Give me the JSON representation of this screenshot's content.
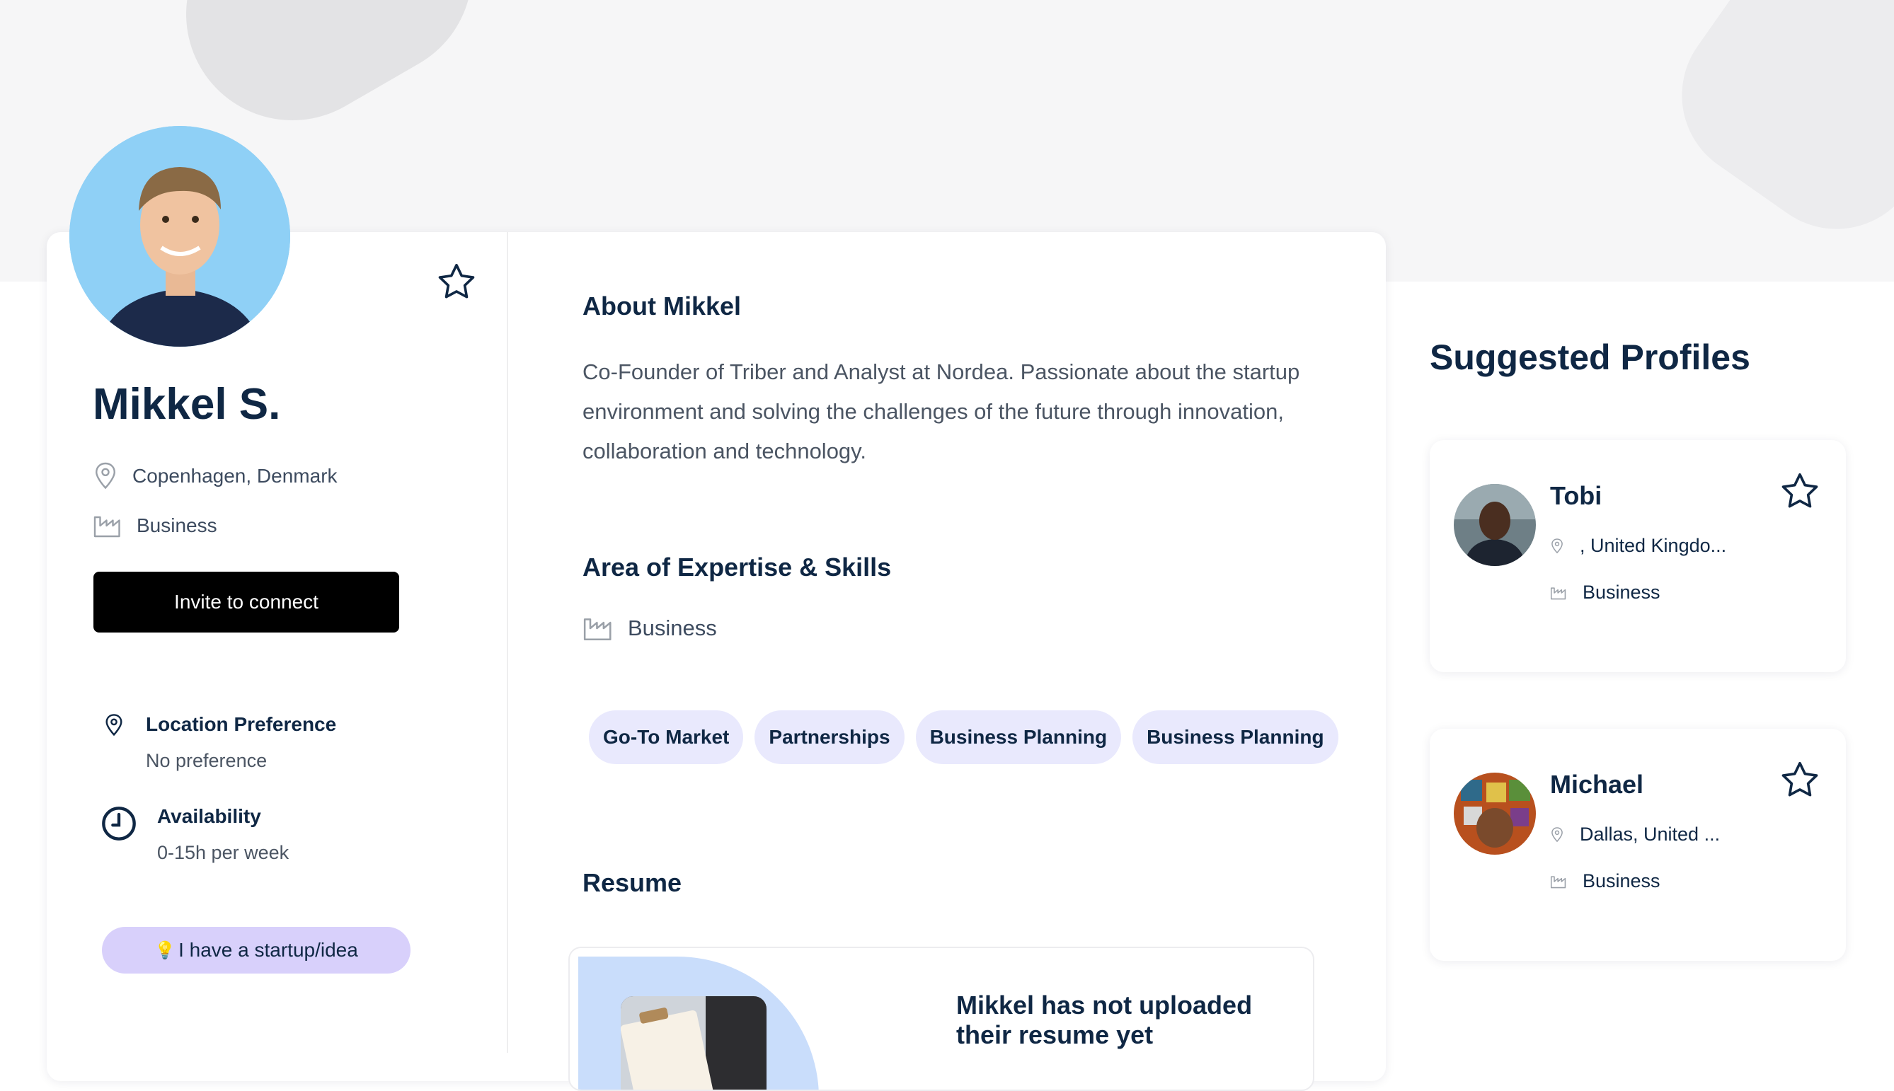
{
  "profile": {
    "name": "Mikkel S.",
    "location": "Copenhagen, Denmark",
    "role": "Business",
    "invite_label": "Invite to connect",
    "location_pref_title": "Location Preference",
    "location_pref_value": "No preference",
    "availability_title": "Availability",
    "availability_value": "0-15h per week",
    "startup_label": "I have a startup/idea",
    "startup_emoji": "💡"
  },
  "about": {
    "heading": "About Mikkel",
    "text": "Co-Founder of Triber and Analyst at Nordea. Passionate about the startup environment and solving the challenges of the future through innovation, collaboration and technology."
  },
  "expertise": {
    "heading": "Area of Expertise & Skills",
    "area": "Business",
    "tags": [
      "Go-To Market",
      "Partnerships",
      "Business Planning",
      "Business Planning"
    ]
  },
  "resume": {
    "heading": "Resume",
    "empty_message": "Mikkel has not uploaded their resume yet"
  },
  "suggested": {
    "heading": "Suggested Profiles",
    "profiles": [
      {
        "name": "Tobi",
        "location": ", United Kingdo...",
        "role": "Business"
      },
      {
        "name": "Michael",
        "location": "Dallas, United ...",
        "role": "Business"
      }
    ]
  },
  "colors": {
    "navy": "#0f2744",
    "avatar_bg": "#8fd0f6",
    "tag_bg": "#e9e9fd",
    "startup_pill_bg": "#d8d0fb",
    "invite_bg": "#000000"
  }
}
